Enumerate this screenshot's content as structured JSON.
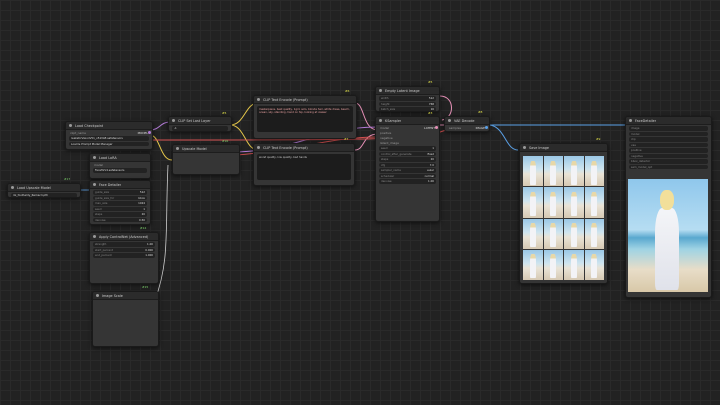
{
  "nodes": {
    "checkpoint": {
      "title": "Load Checkpoint",
      "out_labels": [
        "MODEL",
        "CLIP",
        "VAE"
      ],
      "ckpt_label": "ckpt_name",
      "ckpt_value": "realisticVisionV51_v51VAE.safetensors",
      "button": "Load & Prompt Model Manager"
    },
    "load_lora": {
      "title": "Load LoRA",
      "inputs": [
        "model",
        "clip"
      ],
      "lora_value": "FacefixV4.safetensors",
      "button": "Load & Prompt Model Manager"
    },
    "clip_set_last": {
      "title": "CLIP Set Last Layer",
      "badge": "#5",
      "value": "-1"
    },
    "positive": {
      "title": "CLIP Text Encode (Prompt)",
      "badge": "#6",
      "text": "masterpiece, best quality, 1girl, solo, blonde hair, white dress, beach, ocean, sky, standing, hand on hip, looking at viewer"
    },
    "negative": {
      "title": "CLIP Text Encode (Prompt)",
      "badge": "#7",
      "text": "worst quality, low quality, bad hands"
    },
    "empty_latent": {
      "title": "Empty Latent Image",
      "badge": "#5",
      "rows": [
        [
          "width",
          "512"
        ],
        [
          "height",
          "768"
        ],
        [
          "batch_size",
          "16"
        ]
      ]
    },
    "ksampler": {
      "title": "KSampler",
      "badge": "#3",
      "rows": [
        [
          "seed",
          "1"
        ],
        [
          "control_after_generate",
          "fixed"
        ],
        [
          "steps",
          "20"
        ],
        [
          "cfg",
          "7.0"
        ],
        [
          "sampler_name",
          "euler"
        ],
        [
          "scheduler",
          "normal"
        ],
        [
          "denoise",
          "1.00"
        ]
      ],
      "out": "LATENT"
    },
    "vae_decode": {
      "title": "VAE Decode",
      "badge": "#8",
      "out": "IMAGE"
    },
    "save_image": {
      "title": "Save Image",
      "badge": "#9"
    },
    "preview": {
      "title": "Face Detailer",
      "badge": "#12",
      "rows": [
        [
          "guide_size",
          "512"
        ],
        [
          "guide_size_for",
          "bbox"
        ],
        [
          "max_size",
          "1024"
        ],
        [
          "seed",
          "1"
        ],
        [
          "steps",
          "20"
        ],
        [
          "denoise",
          "0.50"
        ]
      ]
    },
    "mid_a": {
      "title": "Apply ControlNet (Advanced)",
      "badge": "#14",
      "rows": [
        [
          "strength",
          "1.00"
        ],
        [
          "start_percent",
          "0.000"
        ],
        [
          "end_percent",
          "1.000"
        ]
      ]
    },
    "mid_b": {
      "title": "Image Scale",
      "badge": "#15"
    },
    "mid_c": {
      "title": "Upscale Model",
      "badge": "#16"
    },
    "small_left": {
      "title": "Load Upscale Model",
      "badge": "#17",
      "value": "4x_foolhardy_Remacri.pth"
    }
  },
  "colors": {
    "wire_yellow": "#e6c84b",
    "wire_purple": "#b27ad6",
    "wire_red": "#d45050",
    "wire_pink": "#e58fb6",
    "wire_blue": "#5aa0e6",
    "wire_green": "#7dd36b",
    "wire_white": "#cfcfcf"
  }
}
